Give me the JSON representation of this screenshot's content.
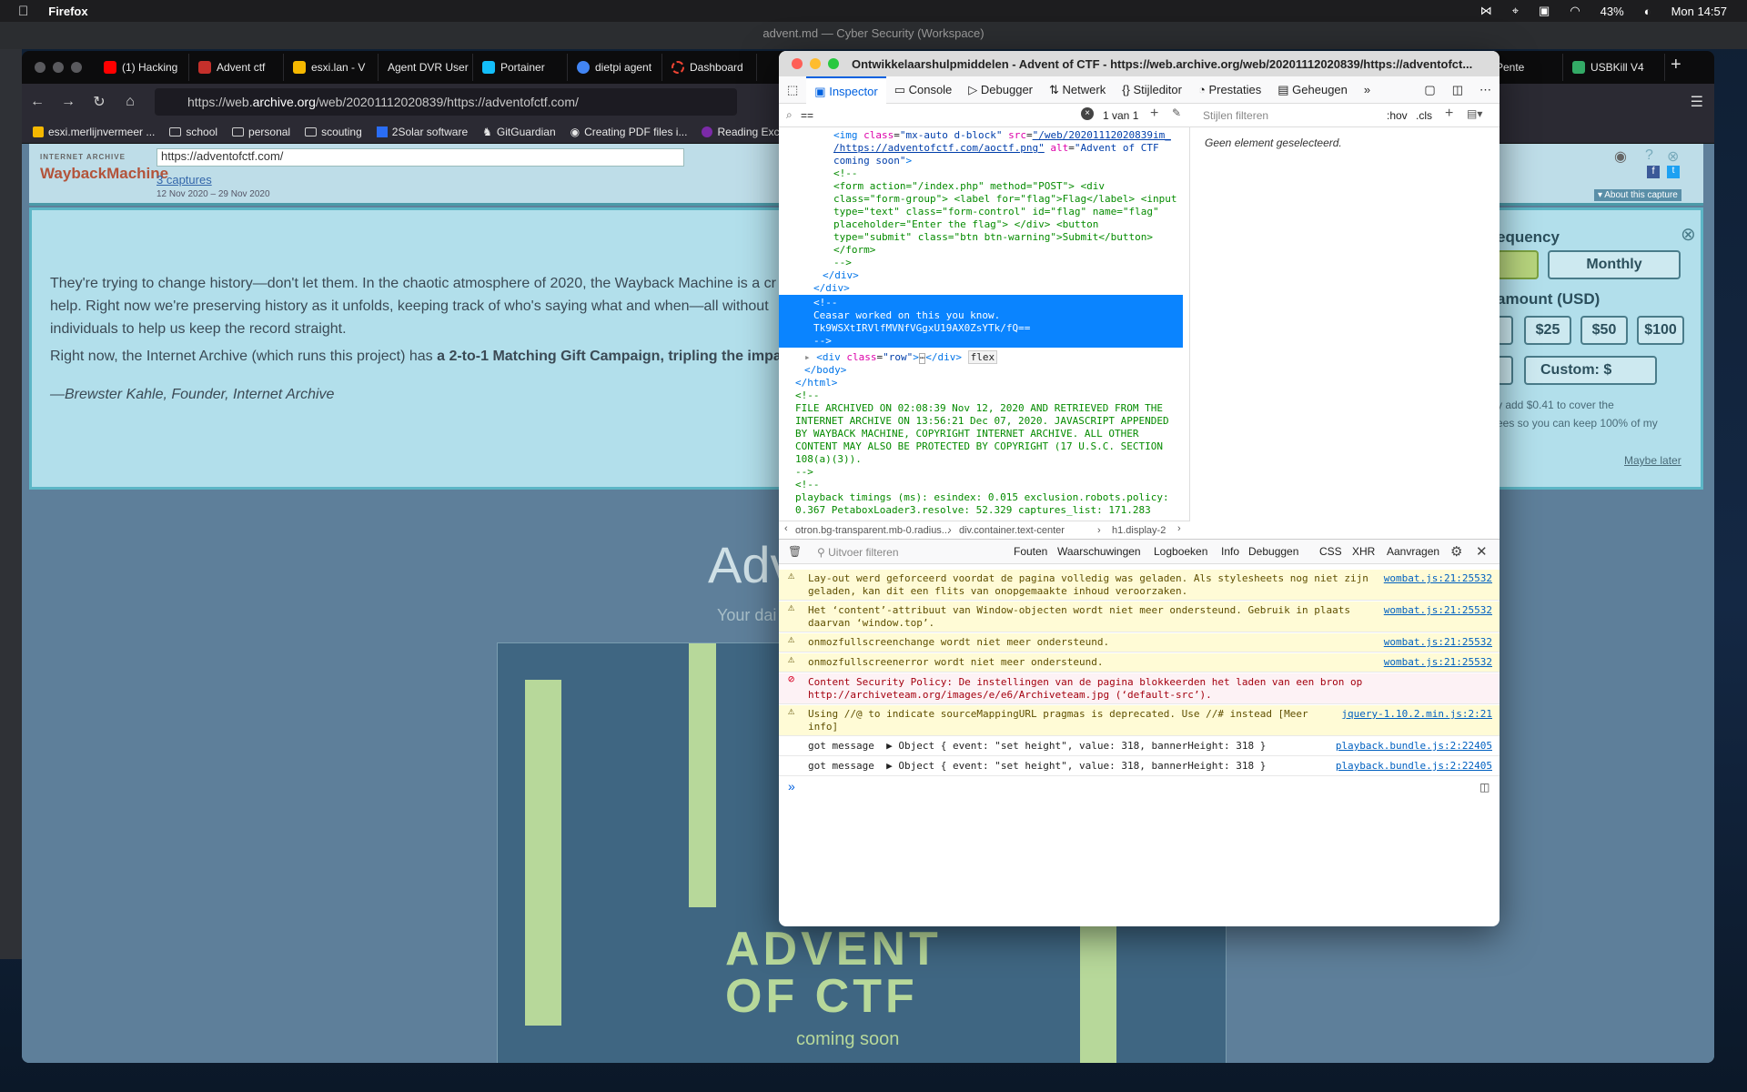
{
  "menubar": {
    "app": "Firefox",
    "battery": "43%",
    "clock": "Mon 14:57"
  },
  "vscode": {
    "title": "advent.md — Cyber Security (Workspace)"
  },
  "firefox": {
    "tabs": [
      {
        "label": "(1) Hacking",
        "color": "#ff0000"
      },
      {
        "label": "Advent ctf",
        "color": "#c4302b"
      },
      {
        "label": "esxi.lan - V",
        "color": "#f5b800"
      },
      {
        "label": "Agent DVR User",
        "color": "#444"
      },
      {
        "label": "Portainer",
        "color": "#13bef9"
      },
      {
        "label": "dietpi agent",
        "color": "#4285f4"
      },
      {
        "label": "Dashboard",
        "color": "#e43"
      }
    ],
    "tabs_right": [
      {
        "label": "D Pente",
        "color": "#555"
      },
      {
        "label": "USBKill V4",
        "color": "#3a6"
      }
    ],
    "url_prefix": "https://web.",
    "url_domain": "archive.org",
    "url_rest": "/web/20201112020839/https://adventofctf.com/",
    "bookmarks": [
      "esxi.merlijnvermeer ...",
      "school",
      "personal",
      "scouting",
      "2Solar software",
      "GitGuardian",
      "Creating PDF files i...",
      "Reading Excel"
    ]
  },
  "wayback": {
    "logo_top": "INTERNET ARCHIVE",
    "logo": "WaybackMachine",
    "url": "https://adventofctf.com/",
    "captures": "3 captures",
    "dates": "12 Nov 2020 – 29 Nov 2020",
    "about": "▾ About this capture"
  },
  "donation": {
    "p1": "They're trying to change history—don't let them. In the chaotic atmosphere of 2020, the Wayback Machine is a cr",
    "p1b": "help. Right now we're preserving history as it unfolds, keeping track of who's saying what and when—all without",
    "p1c": "individuals to help us keep the record straight.",
    "p2": "Right now, the Internet Archive (which runs this project) has ",
    "p2b": "a 2-to-1 Matching Gift Campaign, tripling the impa",
    "quote": "—Brewster Kahle, Founder, Internet Archive",
    "freq": "equency",
    "monthly": "Monthly",
    "amount": "amount (USD)",
    "a25": "$25",
    "a50": "$50",
    "a100": "$100",
    "custom": "Custom: $",
    "fee1": "y add $0.41 to cover the",
    "fee2": "ees so you can keep 100% of my",
    "maybe": "Maybe later"
  },
  "advent": {
    "title": "Adv",
    "subtitle": "Your dai",
    "logo1": "ADVENT",
    "logo2": "OF CTF",
    "logo3": "coming soon"
  },
  "devtools": {
    "title": "Ontwikkelaarshulpmiddelen - Advent of CTF - https://web.archive.org/web/20201112020839/https://adventofct...",
    "tabs": [
      "Inspector",
      "Console",
      "Debugger",
      "Netwerk",
      "Stijleditor",
      "Prestaties",
      "Geheugen"
    ],
    "search": "==",
    "search_count": "1 van 1",
    "rules_filter": "Stijlen filteren",
    "hov": ":hov",
    "cls": ".cls",
    "no_element": "Geen element geselecteerd.",
    "breadcrumbs": [
      "otron.bg-transparent.mb-0.radius...",
      "div.container.text-center",
      "h1.display-2"
    ],
    "comment_line1": "Ceasar worked on this you know.",
    "comment_line2": "Tk9WSXtIRVlfMVNfVGgxU19AX0ZsYTk/fQ==",
    "console_filter": "Uitvoer filteren",
    "console_cats": [
      "Fouten",
      "Waarschuwingen",
      "Logboeken",
      "Info",
      "Debuggen",
      "CSS",
      "XHR",
      "Aanvragen"
    ],
    "messages": [
      {
        "type": "warn",
        "text": "Lay-out werd geforceerd voordat de pagina volledig was geladen. Als stylesheets nog niet zijn\ngeladen, kan dit een flits van onopgemaakte inhoud veroorzaken.",
        "src": "wombat.js:21:25532"
      },
      {
        "type": "warn",
        "text": "Het ‘content’-attribuut van Window-objecten wordt niet meer ondersteund. Gebruik in plaats\ndaarvan ‘window.top’.",
        "src": "wombat.js:21:25532"
      },
      {
        "type": "warn",
        "text": "onmozfullscreenchange wordt niet meer ondersteund.",
        "src": "wombat.js:21:25532"
      },
      {
        "type": "warn",
        "text": "onmozfullscreenerror wordt niet meer ondersteund.",
        "src": "wombat.js:21:25532"
      },
      {
        "type": "err",
        "text": "Content Security Policy: De instellingen van de pagina blokkeerden het laden van een bron op\nhttp://archiveteam.org/images/e/e6/Archiveteam.jpg (‘default-src’).",
        "src": ""
      },
      {
        "type": "warn",
        "text": "Using //@ to indicate sourceMappingURL pragmas is deprecated. Use //# instead [Meer\ninfo]",
        "src": "jquery-1.10.2.min.js:2:21"
      },
      {
        "type": "log",
        "text": "got message  ▶ Object { event: \"set height\", value: 318, bannerHeight: 318 }",
        "src": "playback.bundle.js:2:22405"
      },
      {
        "type": "log",
        "text": "got message  ▶ Object { event: \"set height\", value: 318, bannerHeight: 318 }",
        "src": "playback.bundle.js:2:22405"
      }
    ],
    "prompt": "»"
  }
}
